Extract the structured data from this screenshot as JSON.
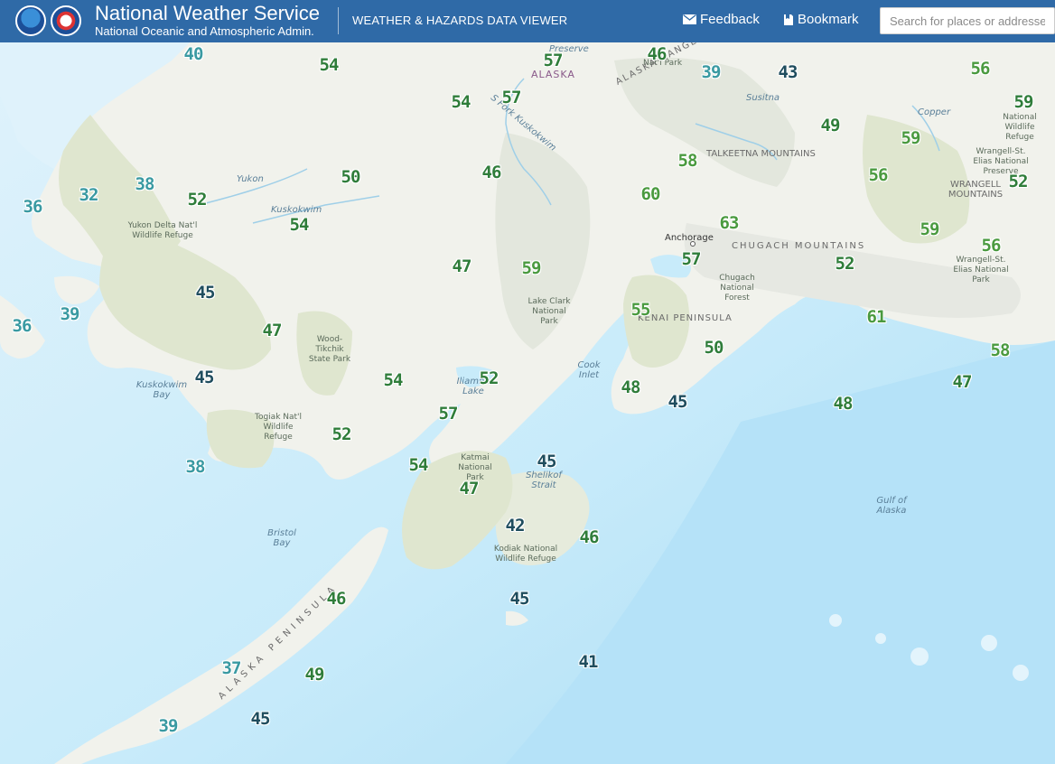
{
  "header": {
    "title": "National Weather Service",
    "subtitle": "National Oceanic and Atmospheric Admin.",
    "viewer_title": "WEATHER & HAZARDS DATA VIEWER",
    "feedback_label": "Feedback",
    "bookmark_label": "Bookmark",
    "search_placeholder": "Search for places or addresses",
    "background_color": "#2f6aa7"
  },
  "map": {
    "labels": {
      "preserve": "Preserve",
      "alaska": "ALASKA",
      "national_park": "Nat'l Park",
      "alaska_range": "ALASKA RANGE",
      "s_fork_kuskokwim": "S Fork Kuskokwim",
      "susitna": "Susitna",
      "copper": "Copper",
      "national_wildlife_refuge_ne": "National Wildlife Refuge",
      "talkeetna": "TALKEETNA MOUNTAINS",
      "wrangell_preserve": "Wrangell-St. Elias National Preserve",
      "wrangell_mtns": "WRANGELL MOUNTAINS",
      "yukon": "Yukon",
      "kuskokwim": "Kuskokwim",
      "yukon_delta": "Yukon Delta Nat'l Wildlife Refuge",
      "anchorage": "Anchorage",
      "chugach": "CHUGACH MOUNTAINS",
      "chugach_forest": "Chugach National Forest",
      "wrangell_park": "Wrangell-St. Elias National Park",
      "lake_clark": "Lake Clark National Park",
      "kenai": "KENAI PENINSULA",
      "wood_tikchik": "Wood-Tikchik State Park",
      "kuskokwim_bay": "Kuskokwim Bay",
      "iliamna": "Iliamna Lake",
      "cook_inlet": "Cook Inlet",
      "togiak": "Togiak Nat'l Wildlife Refuge",
      "katmai": "Katmai National Park",
      "shelikof": "Shelikof Strait",
      "gulf": "Gulf of Alaska",
      "bristol": "Bristol Bay",
      "kodiak": "Kodiak National Wildlife Refuge",
      "ak_peninsula": "ALASKA PENINSULA"
    },
    "temperatures": [
      {
        "value": "40",
        "style": "teal"
      },
      {
        "value": "54",
        "style": "green"
      },
      {
        "value": "57",
        "style": "green"
      },
      {
        "value": "46",
        "style": "green"
      },
      {
        "value": "39",
        "style": "teal"
      },
      {
        "value": "43",
        "style": "dark"
      },
      {
        "value": "56",
        "style": "lightgreen"
      },
      {
        "value": "59",
        "style": "green"
      },
      {
        "value": "54",
        "style": "green"
      },
      {
        "value": "57",
        "style": "green"
      },
      {
        "value": "49",
        "style": "green"
      },
      {
        "value": "59",
        "style": "lightgreen"
      },
      {
        "value": "46",
        "style": "green"
      },
      {
        "value": "58",
        "style": "lightgreen"
      },
      {
        "value": "50",
        "style": "green"
      },
      {
        "value": "38",
        "style": "teal"
      },
      {
        "value": "32",
        "style": "teal"
      },
      {
        "value": "52",
        "style": "green"
      },
      {
        "value": "60",
        "style": "lightgreen"
      },
      {
        "value": "56",
        "style": "lightgreen"
      },
      {
        "value": "52",
        "style": "green"
      },
      {
        "value": "36",
        "style": "teal"
      },
      {
        "value": "54",
        "style": "green"
      },
      {
        "value": "63",
        "style": "lightgreen"
      },
      {
        "value": "59",
        "style": "lightgreen"
      },
      {
        "value": "56",
        "style": "lightgreen"
      },
      {
        "value": "47",
        "style": "green"
      },
      {
        "value": "59",
        "style": "lightgreen"
      },
      {
        "value": "57",
        "style": "green"
      },
      {
        "value": "52",
        "style": "green"
      },
      {
        "value": "45",
        "style": "dark"
      },
      {
        "value": "55",
        "style": "lightgreen"
      },
      {
        "value": "61",
        "style": "lightgreen"
      },
      {
        "value": "39",
        "style": "teal"
      },
      {
        "value": "36",
        "style": "teal"
      },
      {
        "value": "47",
        "style": "green"
      },
      {
        "value": "50",
        "style": "green"
      },
      {
        "value": "58",
        "style": "lightgreen"
      },
      {
        "value": "45",
        "style": "dark"
      },
      {
        "value": "54",
        "style": "green"
      },
      {
        "value": "52",
        "style": "green"
      },
      {
        "value": "48",
        "style": "green"
      },
      {
        "value": "45",
        "style": "dark"
      },
      {
        "value": "48",
        "style": "green"
      },
      {
        "value": "47",
        "style": "green"
      },
      {
        "value": "57",
        "style": "green"
      },
      {
        "value": "52",
        "style": "green"
      },
      {
        "value": "38",
        "style": "teal"
      },
      {
        "value": "54",
        "style": "green"
      },
      {
        "value": "45",
        "style": "dark"
      },
      {
        "value": "47",
        "style": "green"
      },
      {
        "value": "42",
        "style": "dark"
      },
      {
        "value": "46",
        "style": "green"
      },
      {
        "value": "46",
        "style": "green"
      },
      {
        "value": "45",
        "style": "dark"
      },
      {
        "value": "41",
        "style": "dark"
      },
      {
        "value": "37",
        "style": "teal"
      },
      {
        "value": "49",
        "style": "green"
      },
      {
        "value": "39",
        "style": "teal"
      },
      {
        "value": "45",
        "style": "dark"
      }
    ]
  }
}
